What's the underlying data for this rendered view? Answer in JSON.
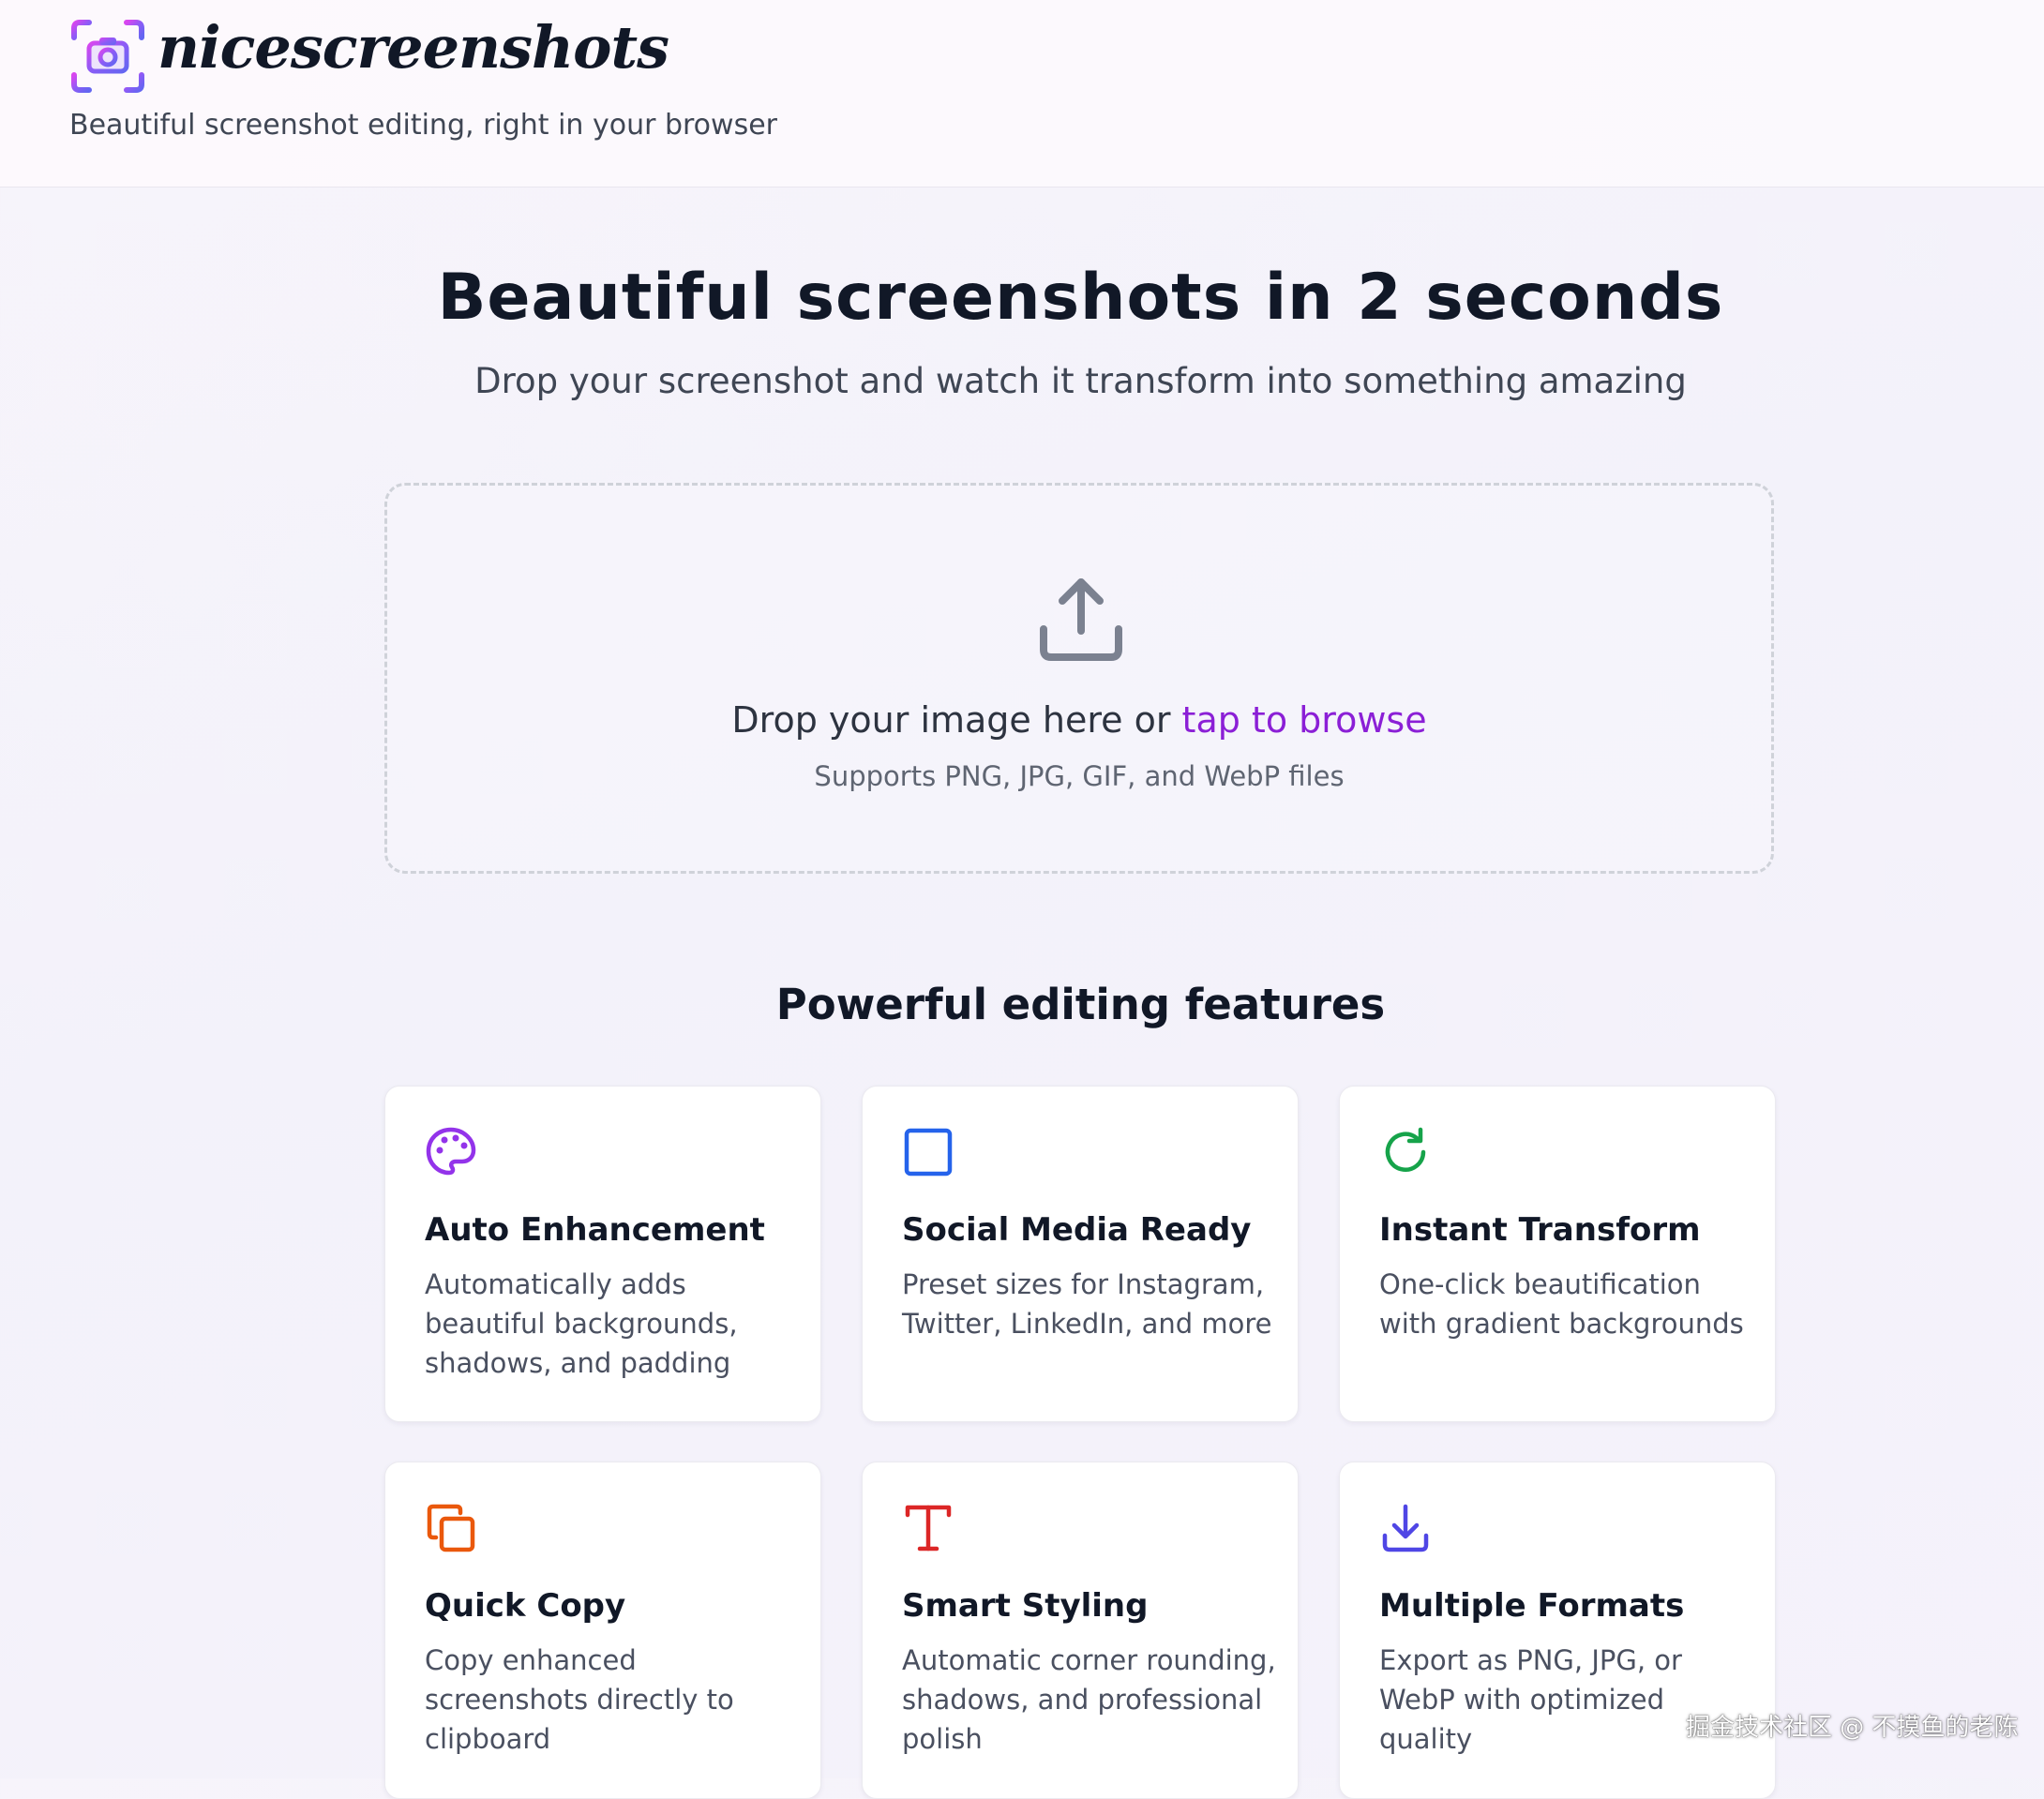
{
  "header": {
    "brand": "nicescreenshots",
    "tagline": "Beautiful screenshot editing, right in your browser",
    "logo_icon": "camera-icon",
    "logo_colors": [
      "#d946ef",
      "#8b5cf6",
      "#6366f1"
    ]
  },
  "hero": {
    "title": "Beautiful screenshots in 2 seconds",
    "subtitle": "Drop your screenshot and watch it transform into something amazing"
  },
  "dropzone": {
    "icon": "upload-icon",
    "prompt_prefix": "Drop your image here or ",
    "browse_link": "tap to browse",
    "hint": "Supports PNG, JPG, GIF, and WebP files",
    "link_color": "#8b1fd6"
  },
  "features": {
    "title": "Powerful editing features",
    "items": [
      {
        "icon": "palette-icon",
        "color": "#9333ea",
        "title": "Auto Enhancement",
        "desc": "Automatically adds beautiful backgrounds, shadows, and padding"
      },
      {
        "icon": "square-icon",
        "color": "#2563eb",
        "title": "Social Media Ready",
        "desc": "Preset sizes for Instagram, Twitter, LinkedIn, and more"
      },
      {
        "icon": "refresh-icon",
        "color": "#16a34a",
        "title": "Instant Transform",
        "desc": "One-click beautification with gradient backgrounds"
      },
      {
        "icon": "copy-icon",
        "color": "#ea580c",
        "title": "Quick Copy",
        "desc": "Copy enhanced screenshots directly to clipboard"
      },
      {
        "icon": "text-icon",
        "color": "#dc2626",
        "title": "Smart Styling",
        "desc": "Automatic corner rounding, shadows, and professional polish"
      },
      {
        "icon": "download-icon",
        "color": "#4f46e5",
        "title": "Multiple Formats",
        "desc": "Export as PNG, JPG, or WebP with optimized quality"
      }
    ]
  },
  "watermark": "掘金技术社区 @ 不摸鱼的老陈"
}
